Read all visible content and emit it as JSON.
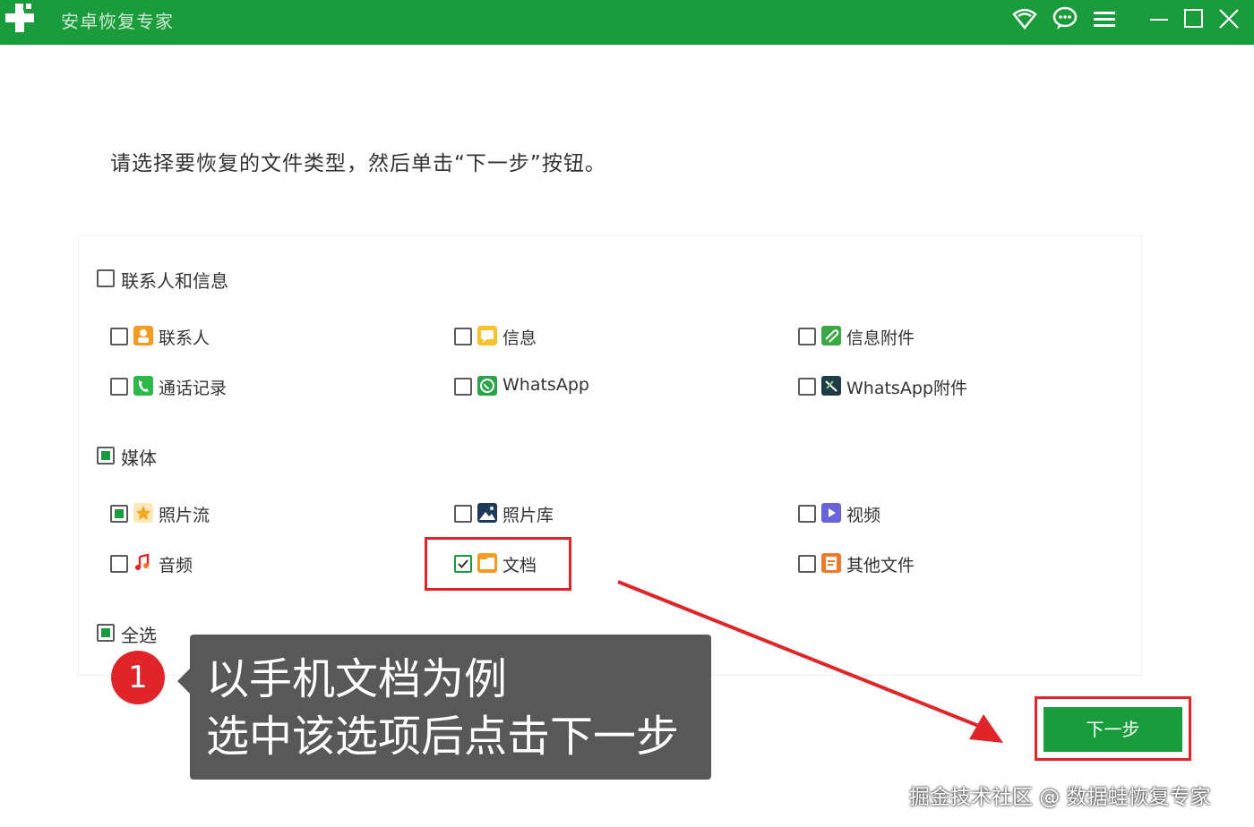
{
  "app": {
    "title": "安卓恢复专家"
  },
  "titlebar_icons": [
    "wifi-icon",
    "chat-icon",
    "menu-icon",
    "minimize-icon",
    "maximize-icon",
    "close-icon"
  ],
  "instruction": "请选择要恢复的文件类型，然后单击“下一步”按钮。",
  "groups": {
    "contacts": {
      "label": "联系人和信息",
      "state": "unchecked",
      "items": [
        {
          "label": "联系人",
          "icon": "contact-icon",
          "state": "unchecked"
        },
        {
          "label": "信息",
          "icon": "message-icon",
          "state": "unchecked"
        },
        {
          "label": "信息附件",
          "icon": "attachment-icon",
          "state": "unchecked"
        },
        {
          "label": "通话记录",
          "icon": "phone-icon",
          "state": "unchecked"
        },
        {
          "label": "WhatsApp",
          "icon": "whatsapp-icon",
          "state": "unchecked"
        },
        {
          "label": "WhatsApp附件",
          "icon": "whatsapp-attachment-icon",
          "state": "unchecked"
        }
      ]
    },
    "media": {
      "label": "媒体",
      "state": "partial",
      "items": [
        {
          "label": "照片流",
          "icon": "photostream-icon",
          "state": "partial"
        },
        {
          "label": "照片库",
          "icon": "photo-library-icon",
          "state": "unchecked"
        },
        {
          "label": "视频",
          "icon": "video-icon",
          "state": "unchecked"
        },
        {
          "label": "音频",
          "icon": "audio-icon",
          "state": "unchecked"
        },
        {
          "label": "文档",
          "icon": "document-icon",
          "state": "checked"
        },
        {
          "label": "其他文件",
          "icon": "other-files-icon",
          "state": "unchecked"
        }
      ]
    },
    "select_all": {
      "label": "全选",
      "state": "partial"
    }
  },
  "next_button": {
    "label": "下一步"
  },
  "callout": {
    "badge": "1",
    "line1": "以手机文档为例",
    "line2": "选中该选项后点击下一步"
  },
  "watermark": "掘金技术社区 @ 数据蛙恢复专家",
  "colors": {
    "brand_green": "#1a9b3c",
    "highlight_red": "#e0252a",
    "callout_gray": "#585858"
  }
}
